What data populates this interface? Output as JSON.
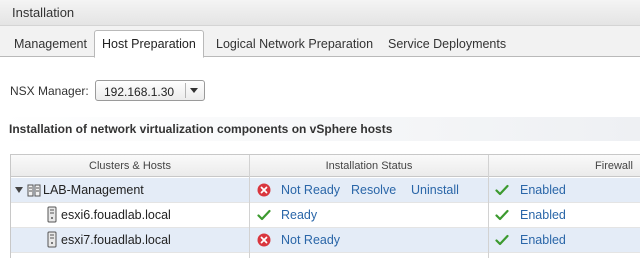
{
  "window": {
    "title": "Installation"
  },
  "tabs": [
    {
      "label": "Management"
    },
    {
      "label": "Host Preparation"
    },
    {
      "label": "Logical Network Preparation"
    },
    {
      "label": "Service Deployments"
    }
  ],
  "nsx_manager": {
    "label": "NSX Manager:",
    "value": "192.168.1.30"
  },
  "section": {
    "title": "Installation of network virtualization components on vSphere hosts"
  },
  "grid": {
    "columns": [
      "Clusters & Hosts",
      "Installation Status",
      "Firewall"
    ],
    "rows": [
      {
        "name": "LAB-Management",
        "status": "Not Ready",
        "actions": [
          "Resolve",
          "Uninstall"
        ],
        "firewall": "Enabled"
      },
      {
        "name": "esxi6.fouadlab.local",
        "status": "Ready",
        "firewall": "Enabled"
      },
      {
        "name": "esxi7.fouadlab.local",
        "status": "Not Ready",
        "firewall": "Enabled"
      }
    ]
  },
  "colors": {
    "link": "#2a66a8",
    "error": "#d9363e",
    "ok": "#3c9a2f",
    "selected_row": "#e4ecf7"
  }
}
